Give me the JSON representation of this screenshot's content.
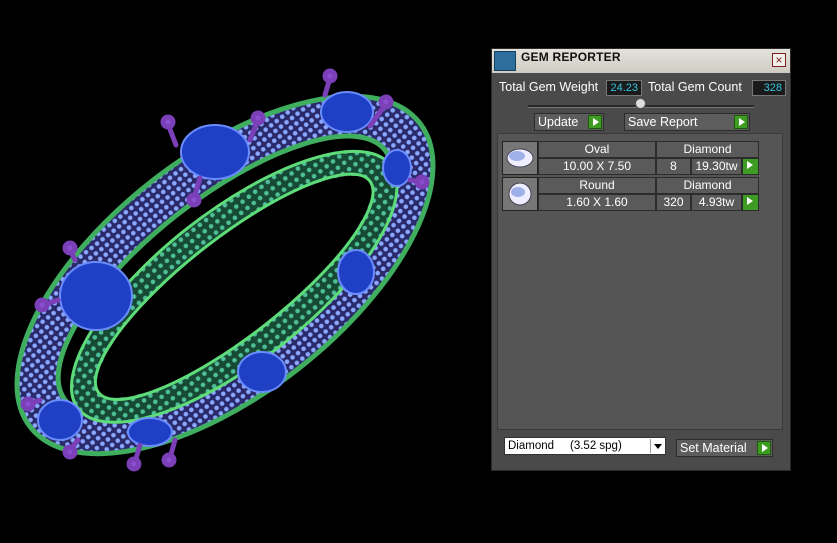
{
  "panel": {
    "title": "GEM REPORTER",
    "close_glyph": "×",
    "total_weight_label": "Total Gem Weight",
    "total_weight_value": "24.23",
    "total_count_label": "Total Gem Count",
    "total_count_value": "328",
    "update_label": "Update",
    "save_report_label": "Save Report",
    "rows": [
      {
        "shape": "Oval",
        "material": "Diamond",
        "size": "10.00 X 7.50",
        "count": "8",
        "weight": "19.30tw"
      },
      {
        "shape": "Round",
        "material": "Diamond",
        "size": "1.60 X 1.60",
        "count": "320",
        "weight": "4.93tw"
      }
    ],
    "material_select": "Diamond     (3.52 spg)",
    "set_material_label": "Set Material"
  },
  "colors": {
    "band": "#3fae5f",
    "pave": "#7fa0ff",
    "prong": "#7b3fb8",
    "gem": "#2a3fbf",
    "value_text": "#35c4e0",
    "play_button": "#3f9c22"
  },
  "icons": [
    "gem-reporter-icon",
    "close-icon",
    "slider-knob-icon",
    "play-arrow-icon",
    "oval-gem-icon",
    "round-gem-icon",
    "dropdown-arrow-icon"
  ]
}
